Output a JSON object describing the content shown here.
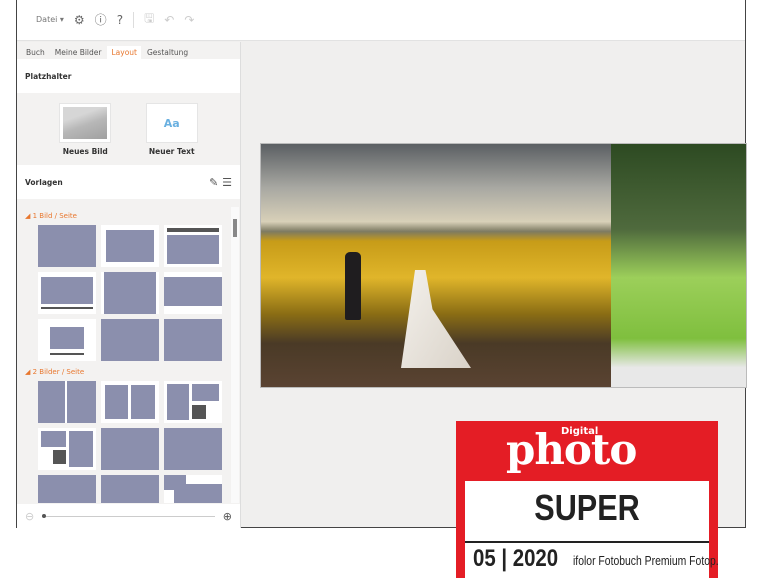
{
  "toolbar": {
    "file_menu": "Datei",
    "file_menu_arrow": "▾",
    "settings_icon": "⚙",
    "info_icon": "ⓘ",
    "help_icon": "?",
    "save_icon": "🖫",
    "undo_icon": "↶",
    "redo_icon": "↷"
  },
  "tabs": [
    {
      "label": "Buch"
    },
    {
      "label": "Meine Bilder"
    },
    {
      "label": "Layout",
      "active": true
    },
    {
      "label": "Gestaltung"
    }
  ],
  "placeholder": {
    "title": "Platzhalter",
    "new_image": "Neues Bild",
    "new_text": "Neuer Text",
    "text_sample": "Aa"
  },
  "templates": {
    "title": "Vorlagen",
    "groups": [
      {
        "label": "◢  1 Bild / Seite"
      },
      {
        "label": "◢  2 Bilder / Seite"
      }
    ]
  },
  "zoom": {
    "out_icon": "⊖",
    "in_icon": "⊕",
    "level": 0
  },
  "badge": {
    "brand_small": "Digital",
    "brand": "photo",
    "rating": "SUPER",
    "issue": "05 | 2020",
    "product": "ifolor Fotobuch Premium Fotop."
  },
  "colors": {
    "accent": "#e8772e",
    "badge_red": "#e41d25",
    "template_fill": "#8b8fad"
  }
}
